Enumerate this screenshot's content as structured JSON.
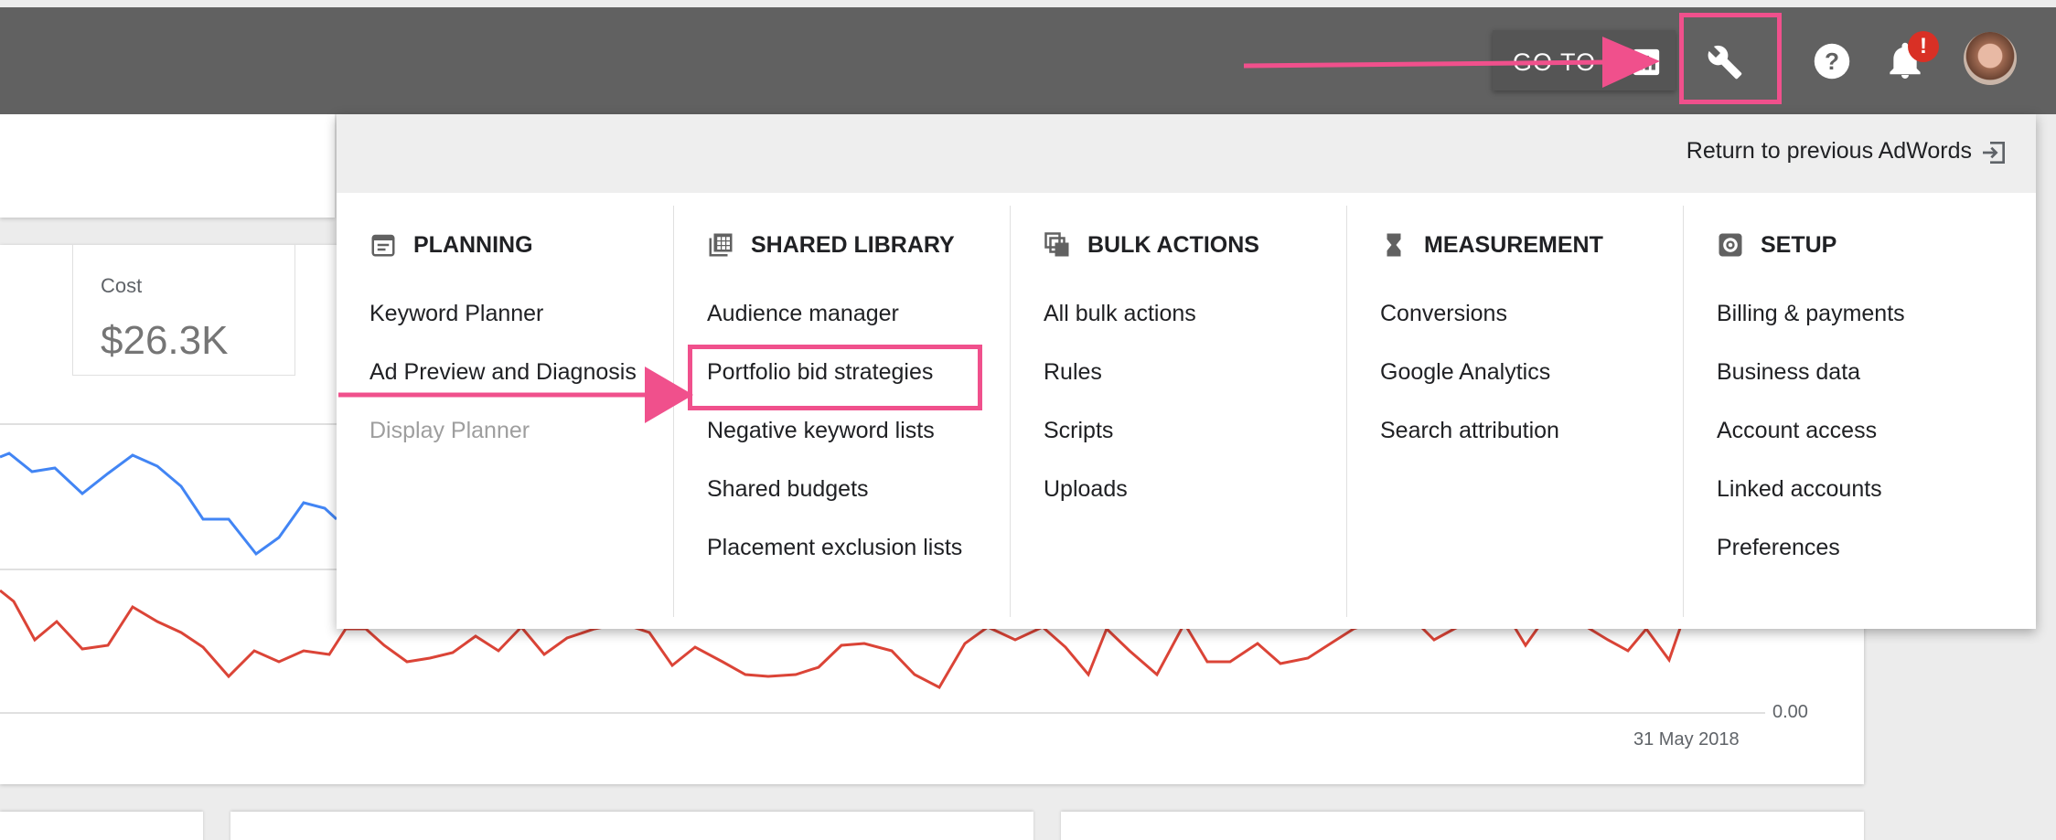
{
  "topbar": {
    "goto_label": "GO TO",
    "icons": [
      "reports-icon",
      "tools-wrench-icon",
      "help-icon",
      "notifications-bell-icon",
      "account-avatar"
    ],
    "notification_badge": "!"
  },
  "stat": {
    "label": "Cost",
    "value": "$26.3K"
  },
  "chart": {
    "axis_value": "0.00",
    "date_label": "31 May 2018"
  },
  "menu": {
    "return_label": "Return to previous AdWords",
    "columns": [
      {
        "title": "PLANNING",
        "icon": "calendar-icon",
        "items": [
          "Keyword Planner",
          "Ad Preview and Diagnosis",
          "Display Planner"
        ]
      },
      {
        "title": "SHARED LIBRARY",
        "icon": "library-icon",
        "items": [
          "Audience manager",
          "Portfolio bid strategies",
          "Negative keyword lists",
          "Shared budgets",
          "Placement exclusion lists"
        ]
      },
      {
        "title": "BULK ACTIONS",
        "icon": "copy-icon",
        "items": [
          "All bulk actions",
          "Rules",
          "Scripts",
          "Uploads"
        ]
      },
      {
        "title": "MEASUREMENT",
        "icon": "hourglass-icon",
        "items": [
          "Conversions",
          "Google Analytics",
          "Search attribution"
        ]
      },
      {
        "title": "SETUP",
        "icon": "settings-icon",
        "items": [
          "Billing & payments",
          "Business data",
          "Account access",
          "Linked accounts",
          "Preferences"
        ]
      }
    ]
  },
  "colors": {
    "topbar": "#616161",
    "highlight": "#f0508c",
    "line_blue": "#4285f4",
    "line_red": "#db4437",
    "badge": "#d93025"
  }
}
